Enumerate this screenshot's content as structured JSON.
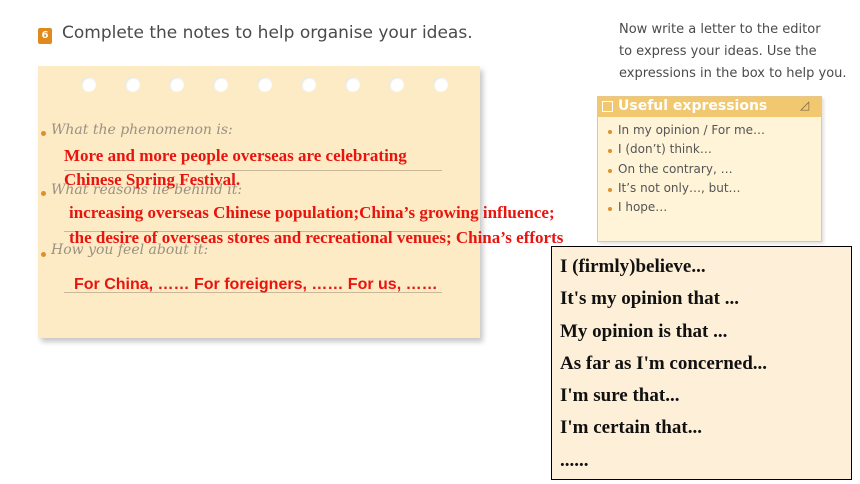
{
  "exercise": {
    "number": "6",
    "heading": "Complete the notes to help organise your ideas."
  },
  "notes": {
    "prompts": [
      "What the phenomenon is:",
      "What reasons lie behind it:",
      "How you feel about it:"
    ],
    "answers": {
      "phenomenon_line1": "More and more people overseas are celebrating",
      "phenomenon_line2": "Chinese Spring Festival.",
      "reasons_line1": "increasing overseas Chinese population;China’s growing influence;",
      "reasons_line2": "the desire of overseas stores and recreational venues; China’s efforts",
      "feelings": "For China, ……  For foreigners, …… For us, ……"
    }
  },
  "instructions": {
    "lines": [
      "Now write a letter to the editor",
      "to express your ideas. Use the",
      "expressions in the box to help you."
    ]
  },
  "useful_expressions": {
    "title": "Useful expressions",
    "items": [
      "In my opinion / For me…",
      "I (don’t) think…",
      "On the contrary, …",
      "It’s not only…, but…",
      "I hope…"
    ]
  },
  "believe_box": {
    "lines": [
      "I (firmly)believe...",
      "It's my opinion that ...",
      "My opinion is that ...",
      "As far as I'm concerned...",
      "I'm sure that...",
      "I'm certain that...",
      "......"
    ]
  },
  "colors": {
    "note_paper": "#fdebc6",
    "answer_red": "#e8140e",
    "accent_orange": "#e0902a",
    "useful_header": "#f1c86f"
  }
}
